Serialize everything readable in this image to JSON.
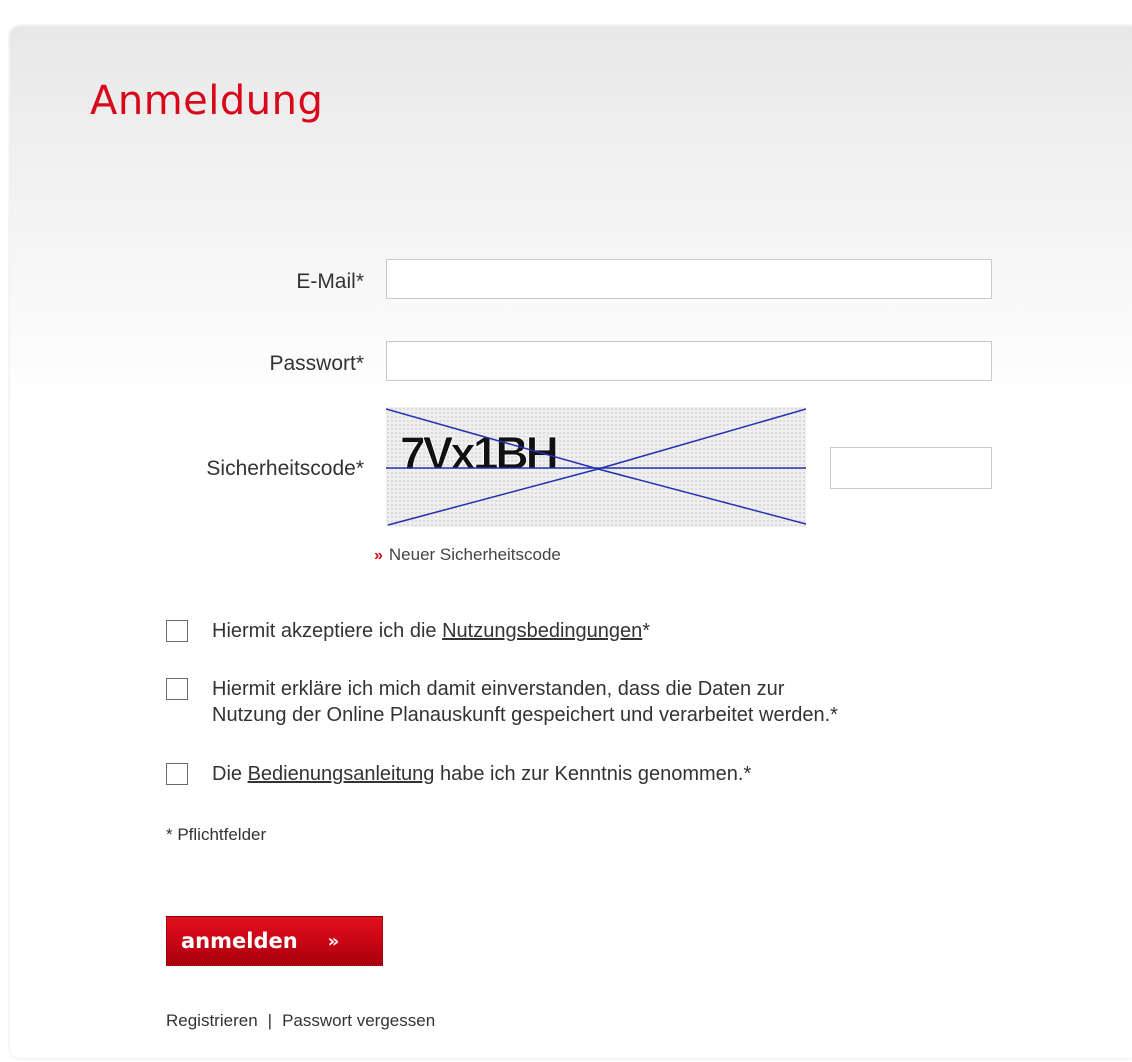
{
  "title": "Anmeldung",
  "form": {
    "email_label": "E-Mail*",
    "email_value": "",
    "password_label": "Passwort*",
    "password_value": "",
    "captcha_label": "Sicherheitscode*",
    "captcha_text": "7Vx1BH",
    "captcha_value": "",
    "new_code_arrows": "»",
    "new_code_label": "Neuer Sicherheitscode"
  },
  "checkboxes": {
    "terms": {
      "prefix": "Hiermit akzeptiere ich die ",
      "link": "Nutzungsbedingungen",
      "suffix": "*",
      "checked": false
    },
    "consent": {
      "line1": "Hiermit erkläre ich mich damit einverstanden, dass die Daten zur",
      "line2": "Nutzung der Online Planauskunft gespeichert und verarbeitet werden.*",
      "checked": false
    },
    "manual": {
      "prefix": "Die ",
      "link": "Bedienungsanleitung",
      "suffix": " habe ich zur Kenntnis genommen.*",
      "checked": false
    }
  },
  "required_note": "* Pflichtfelder",
  "submit": {
    "label": "anmelden",
    "arrow": "»"
  },
  "footer": {
    "register": "Registrieren",
    "separator": "|",
    "forgot_password": "Passwort vergessen"
  },
  "colors": {
    "accent": "#d8071a",
    "text": "#333333",
    "captcha_lines": "#2330b0"
  }
}
